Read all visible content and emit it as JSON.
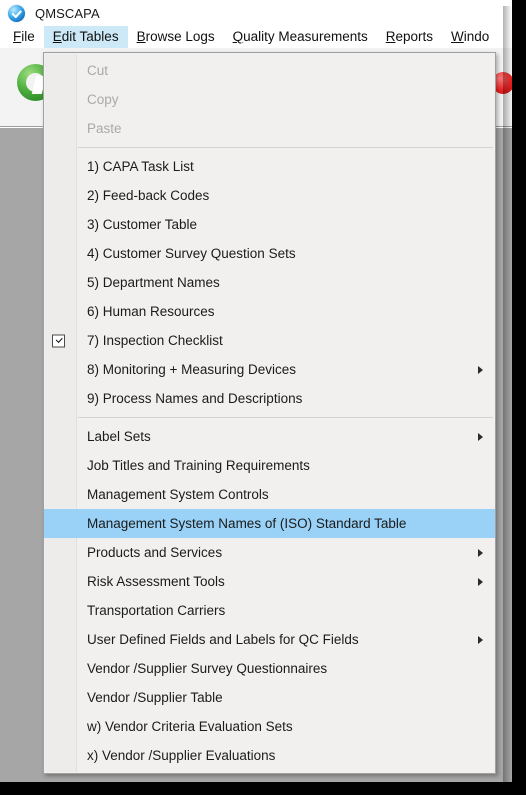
{
  "window": {
    "title": "QMSCAPA",
    "app_icon": "globe-check-icon"
  },
  "menubar": {
    "items": [
      {
        "label": "File",
        "mnemonic": "F",
        "active": false
      },
      {
        "label": "Edit Tables",
        "mnemonic": "E",
        "active": true
      },
      {
        "label": "Browse Logs",
        "mnemonic": "B",
        "active": false
      },
      {
        "label": "Quality Measurements",
        "mnemonic": "Q",
        "active": false
      },
      {
        "label": "Reports",
        "mnemonic": "R",
        "active": false
      },
      {
        "label": "Windo",
        "mnemonic": "W",
        "active": false
      }
    ]
  },
  "toolbar": {
    "icons": [
      {
        "name": "approve-green-icon",
        "color": "#4caf3f"
      },
      {
        "name": "record-red-icon",
        "color": "#ee2222"
      }
    ]
  },
  "dropdown": {
    "name": "Edit Tables",
    "highlight_color": "#99d1f7",
    "groups": [
      {
        "items": [
          {
            "label": "Cut",
            "disabled": true,
            "submenu": false,
            "checked": false,
            "highlight": false
          },
          {
            "label": "Copy",
            "disabled": true,
            "submenu": false,
            "checked": false,
            "highlight": false
          },
          {
            "label": "Paste",
            "disabled": true,
            "submenu": false,
            "checked": false,
            "highlight": false
          }
        ]
      },
      {
        "items": [
          {
            "label": "1) CAPA Task List",
            "disabled": false,
            "submenu": false,
            "checked": false,
            "highlight": false
          },
          {
            "label": "2) Feed-back Codes",
            "disabled": false,
            "submenu": false,
            "checked": false,
            "highlight": false
          },
          {
            "label": "3) Customer Table",
            "disabled": false,
            "submenu": false,
            "checked": false,
            "highlight": false
          },
          {
            "label": "4) Customer Survey Question Sets",
            "disabled": false,
            "submenu": false,
            "checked": false,
            "highlight": false
          },
          {
            "label": "5) Department Names",
            "disabled": false,
            "submenu": false,
            "checked": false,
            "highlight": false
          },
          {
            "label": "6) Human Resources",
            "disabled": false,
            "submenu": false,
            "checked": false,
            "highlight": false
          },
          {
            "label": "7) Inspection Checklist",
            "disabled": false,
            "submenu": false,
            "checked": true,
            "highlight": false
          },
          {
            "label": "8) Monitoring + Measuring Devices",
            "disabled": false,
            "submenu": true,
            "checked": false,
            "highlight": false
          },
          {
            "label": "9) Process Names and Descriptions",
            "disabled": false,
            "submenu": false,
            "checked": false,
            "highlight": false
          }
        ]
      },
      {
        "items": [
          {
            "label": "Label Sets",
            "disabled": false,
            "submenu": true,
            "checked": false,
            "highlight": false
          },
          {
            "label": "Job Titles and Training Requirements",
            "disabled": false,
            "submenu": false,
            "checked": false,
            "highlight": false
          },
          {
            "label": "Management System Controls",
            "disabled": false,
            "submenu": false,
            "checked": false,
            "highlight": false
          },
          {
            "label": "Management System Names of (ISO) Standard Table",
            "disabled": false,
            "submenu": false,
            "checked": false,
            "highlight": true
          },
          {
            "label": "Products and Services",
            "disabled": false,
            "submenu": true,
            "checked": false,
            "highlight": false
          },
          {
            "label": "Risk Assessment Tools",
            "disabled": false,
            "submenu": true,
            "checked": false,
            "highlight": false
          },
          {
            "label": "Transportation Carriers",
            "disabled": false,
            "submenu": false,
            "checked": false,
            "highlight": false
          },
          {
            "label": "User Defined Fields and Labels for QC Fields",
            "disabled": false,
            "submenu": true,
            "checked": false,
            "highlight": false
          },
          {
            "label": "Vendor /Supplier Survey Questionnaires",
            "disabled": false,
            "submenu": false,
            "checked": false,
            "highlight": false
          },
          {
            "label": "Vendor /Supplier Table",
            "disabled": false,
            "submenu": false,
            "checked": false,
            "highlight": false
          },
          {
            "label": "w) Vendor Criteria Evaluation Sets",
            "disabled": false,
            "submenu": false,
            "checked": false,
            "highlight": false
          },
          {
            "label": "x) Vendor /Supplier Evaluations",
            "disabled": false,
            "submenu": false,
            "checked": false,
            "highlight": false
          }
        ]
      }
    ]
  }
}
